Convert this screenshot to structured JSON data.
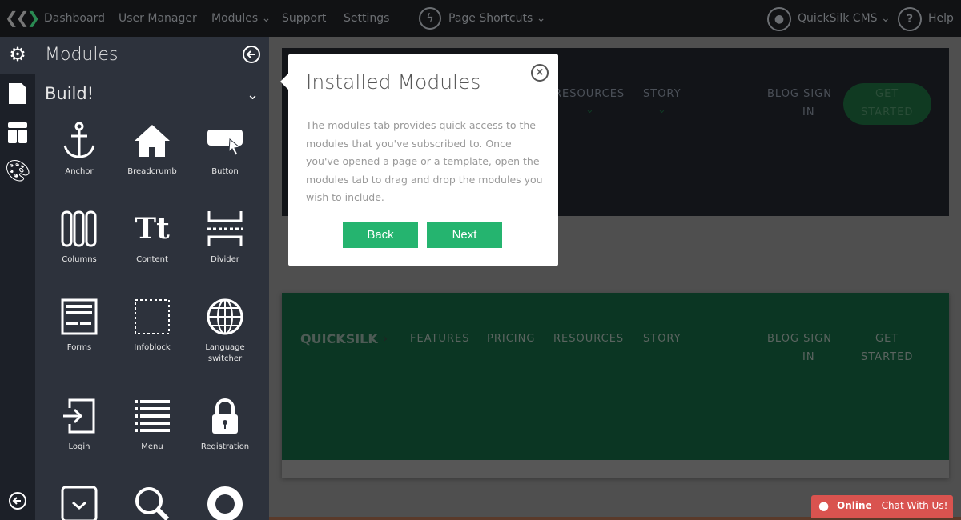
{
  "topbar": {
    "nav": [
      "Dashboard",
      "User Manager",
      "Modules",
      "Support",
      "Settings"
    ],
    "page_shortcuts": "Page Shortcuts",
    "account": "QuickSilk CMS",
    "help": "Help"
  },
  "panel": {
    "title": "Modules",
    "section": "Build!",
    "modules": [
      "Anchor",
      "Breadcrumb",
      "Button",
      "Columns",
      "Content",
      "Divider",
      "Forms",
      "Infoblock",
      "Language switcher",
      "Login",
      "Menu",
      "Registration"
    ]
  },
  "preview": {
    "brand": "QUICKSILK",
    "nav": [
      "FEATURES",
      "PRICING",
      "RESOURCES",
      "STORY"
    ],
    "blog_sign": "BLOG SIGN",
    "in": "IN",
    "get": "GET",
    "started": "STARTED"
  },
  "popup": {
    "title": "Installed Modules",
    "body": "The modules tab provides quick access to the modules that you've subscribed to. Once you've opened a page or a template, open the modules tab to drag and drop the modules you wish to include.",
    "back": "Back",
    "next": "Next"
  },
  "chat": {
    "status": "Online",
    "label": " - Chat With Us!"
  },
  "colors": {
    "accent": "#25b46f",
    "chat": "#d9534f"
  }
}
